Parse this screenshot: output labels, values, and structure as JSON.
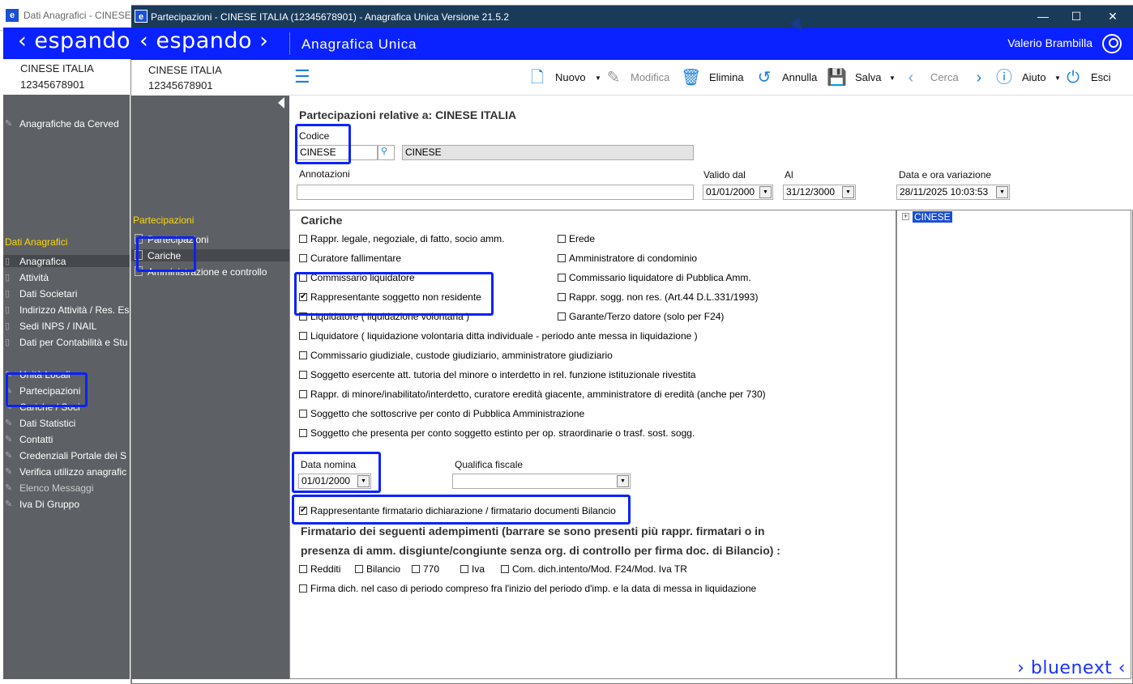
{
  "bg_window": {
    "title": "Dati Anagrafici - CINESE",
    "logo": "‹ espando ›",
    "company_name": "CINESE ITALIA",
    "company_code": "12345678901",
    "cerved_item": "Anagrafiche da Cerved",
    "section_title": "Dati Anagrafici",
    "nav_items": [
      "Anagrafica",
      "Attività",
      "Dati Societari",
      "Indirizzo Attività / Res. Es",
      "Sedi INPS / INAIL",
      "Dati per Contabilità e Stu"
    ],
    "nav_items2": [
      "Unità Locali",
      "Partecipazioni",
      "Cariche / Soci",
      "Dati Statistici",
      "Contatti",
      "Credenziali Portale dei S",
      "Verifica utilizzo anagrafic",
      "Elenco Messaggi",
      "Iva Di Gruppo"
    ]
  },
  "window": {
    "title": "Partecipazioni - CINESE ITALIA (12345678901) - Anagrafica Unica Versione 21.5.2",
    "minimize": "—",
    "maximize": "☐",
    "close": "✕"
  },
  "brand": {
    "logo": "‹ espando ›",
    "app_name": "Anagrafica Unica",
    "user": "Valerio Brambilla"
  },
  "left": {
    "company_name": "CINESE ITALIA",
    "company_code": "12345678901",
    "tree_title": "Partecipazioni",
    "tree_items": [
      "Partecipazioni",
      "Cariche",
      "Amministrazione e controllo"
    ]
  },
  "toolbar": {
    "menu": "☰",
    "nuovo": "Nuovo",
    "modifica": "Modifica",
    "elimina": "Elimina",
    "annulla": "Annulla",
    "salva": "Salva",
    "cerca": "Cerca",
    "aiuto": "Aiuto",
    "esci": "Esci"
  },
  "form": {
    "heading": "Partecipazioni relative a: CINESE ITALIA",
    "codice_label": "Codice",
    "codice_value": "CINESE",
    "codice_desc": "CINESE",
    "annotazioni_label": "Annotazioni",
    "annotazioni_value": "",
    "valido_dal_label": "Valido dal",
    "valido_dal_value": "01/01/2000",
    "al_label": "Al",
    "al_value": "31/12/3000",
    "data_var_label": "Data e ora variazione",
    "data_var_value": "28/11/2025 10:03:53"
  },
  "cariche": {
    "title": "Cariche",
    "left_col": [
      {
        "label": "Rappr. legale, negoziale, di fatto, socio amm.",
        "checked": false
      },
      {
        "label": "Curatore fallimentare",
        "checked": false
      },
      {
        "label": "Commissario liquidatore",
        "checked": false
      },
      {
        "label": "Rappresentante soggetto non residente",
        "checked": true
      },
      {
        "label": "Liquidatore ( liquidazione volontaria )",
        "checked": false
      }
    ],
    "right_col": [
      {
        "label": "Erede",
        "checked": false
      },
      {
        "label": "Amministratore di condominio",
        "checked": false
      },
      {
        "label": "Commissario liquidatore di Pubblica Amm.",
        "checked": false
      },
      {
        "label": "Rappr. sogg. non res.  (Art.44 D.L.331/1993)",
        "checked": false
      },
      {
        "label": "Garante/Terzo datore (solo per F24)",
        "checked": false
      }
    ],
    "full_rows": [
      {
        "label": "Liquidatore ( liquidazione volontaria ditta individuale - periodo ante messa in liquidazione )",
        "checked": false
      },
      {
        "label": "Commissario giudiziale, custode giudiziario, amministratore giudiziario",
        "checked": false
      },
      {
        "label": "Soggetto esercente att. tutoria del minore o interdetto in rel. funzione istituzionale rivestita",
        "checked": false
      },
      {
        "label": "Rappr. di minore/inabilitato/interdetto, curatore eredità giacente, amministratore di eredità (anche per 730)",
        "checked": false
      },
      {
        "label": "Soggetto che sottoscrive  per conto di Pubblica Amministrazione",
        "checked": false
      },
      {
        "label": "Soggetto che presenta per conto soggetto estinto per op. straordinarie o trasf. sost. sogg.",
        "checked": false
      }
    ],
    "data_nomina_label": "Data nomina",
    "data_nomina_value": "01/01/2000",
    "qualifica_label": "Qualifica fiscale",
    "qualifica_value": "",
    "firmatario": {
      "label": "Rappresentante firmatario dichiarazione / firmatario documenti Bilancio",
      "checked": true
    },
    "adempimenti_title_1": "Firmatario dei seguenti adempimenti (barrare  se  sono presenti più rappr. firmatari o in",
    "adempimenti_title_2": "presenza di amm. disgiunte/congiunte senza org. di controllo per firma doc. di Bilancio) :",
    "adempimenti": [
      "Redditi",
      "Bilancio",
      "770",
      "Iva",
      "Com. dich.intento/Mod. F24/Mod. Iva TR"
    ],
    "firma_row": "Firma dich. nel caso di periodo compreso fra l'inizio del periodo d'imp. e la data di messa in liquidazione"
  },
  "right": {
    "tree_node": "CINESE",
    "footer_logo": "› bluenext ‹"
  }
}
